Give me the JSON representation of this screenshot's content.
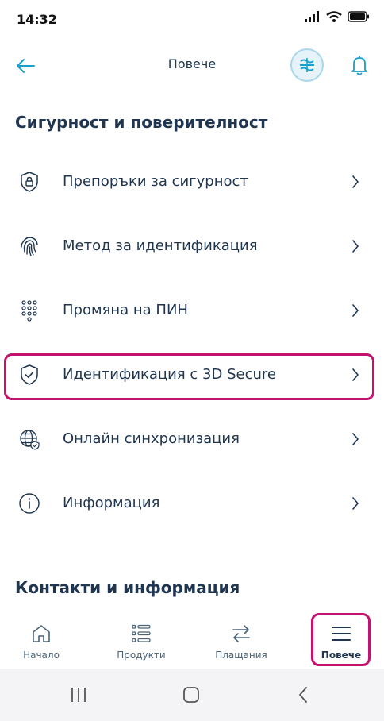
{
  "status_bar": {
    "time": "14:32"
  },
  "header": {
    "title": "Повече"
  },
  "sections": [
    {
      "title": "Сигурност и поверителност"
    },
    {
      "title": "Контакти и информация"
    }
  ],
  "menu": {
    "items": [
      {
        "label": "Препоръки за сигурност",
        "icon": "shield-lock-icon"
      },
      {
        "label": "Метод за идентификация",
        "icon": "fingerprint-icon"
      },
      {
        "label": "Промяна на ПИН",
        "icon": "keypad-icon"
      },
      {
        "label": "Идентификация с 3D Secure",
        "icon": "shield-check-icon",
        "highlighted": true
      },
      {
        "label": "Онлайн синхронизация",
        "icon": "globe-shield-icon"
      },
      {
        "label": "Информация",
        "icon": "info-icon"
      }
    ]
  },
  "bottom_nav": {
    "items": [
      {
        "label": "Начало",
        "icon": "home-icon"
      },
      {
        "label": "Продукти",
        "icon": "list-icon"
      },
      {
        "label": "Плащания",
        "icon": "transfer-icon"
      },
      {
        "label": "Повече",
        "icon": "menu-icon",
        "active": true
      }
    ]
  },
  "colors": {
    "accent": "#1a9fcb",
    "text": "#1f3550",
    "highlight": "#c4136f"
  }
}
